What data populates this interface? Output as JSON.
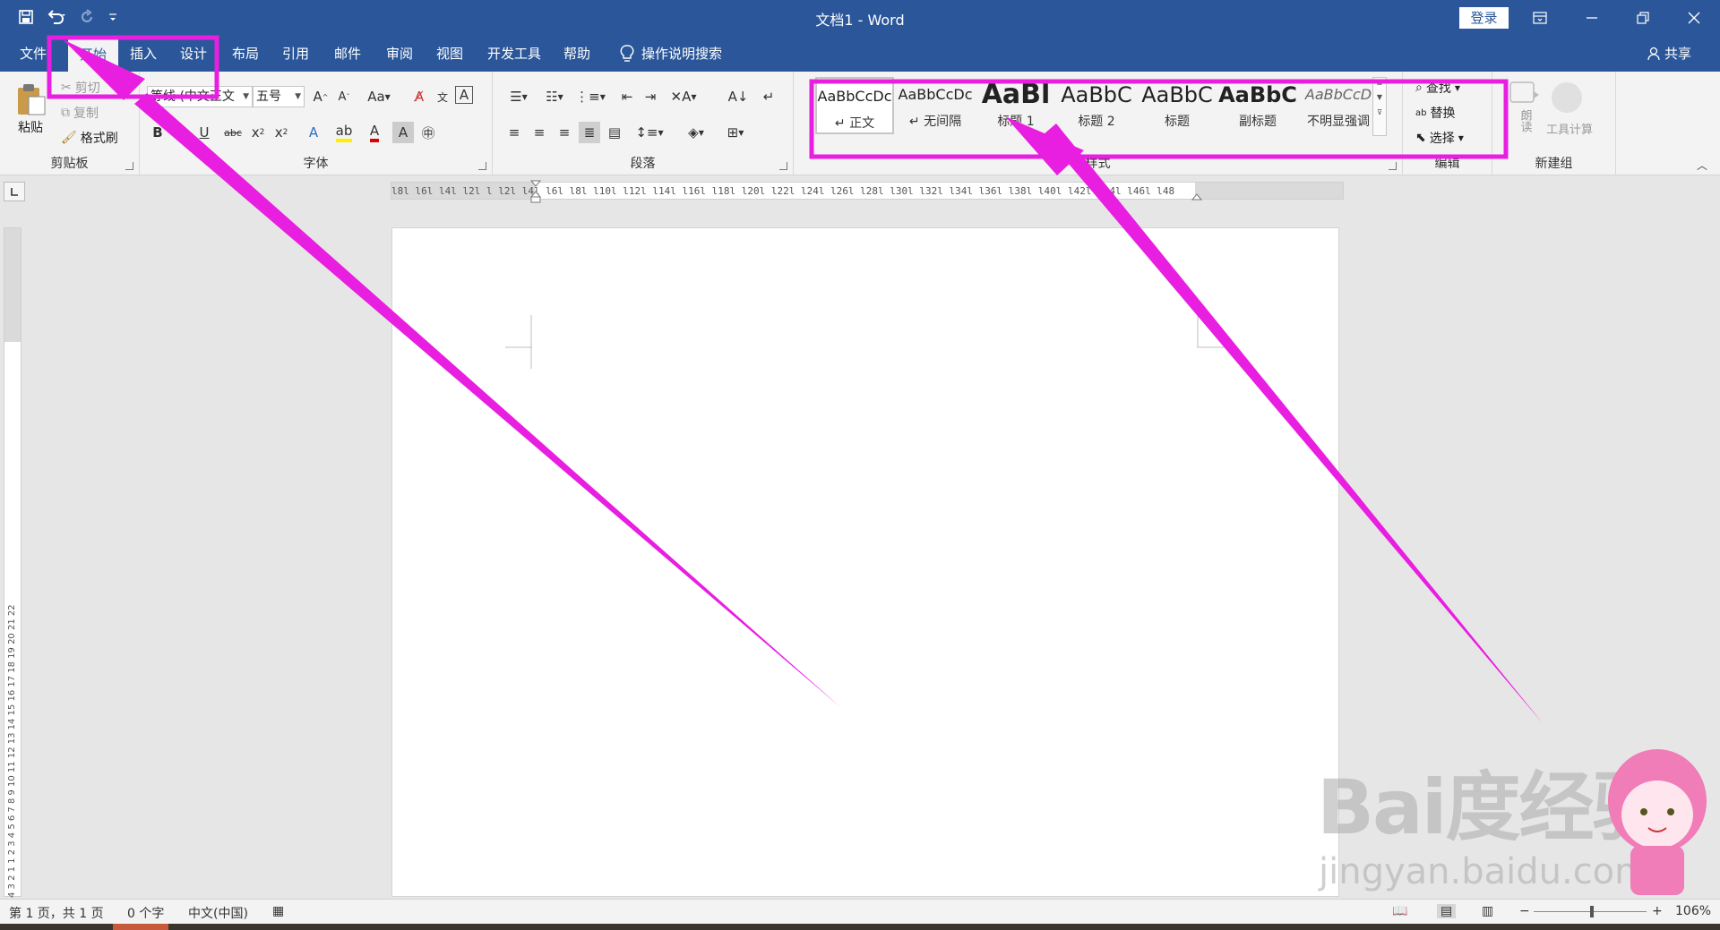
{
  "app": {
    "title": "文档1 - Word",
    "login_label": "登录"
  },
  "tabs": [
    {
      "label": "文件"
    },
    {
      "label": "开始"
    },
    {
      "label": "插入"
    },
    {
      "label": "设计"
    },
    {
      "label": "布局"
    },
    {
      "label": "引用"
    },
    {
      "label": "邮件"
    },
    {
      "label": "审阅"
    },
    {
      "label": "视图"
    },
    {
      "label": "开发工具"
    },
    {
      "label": "帮助"
    }
  ],
  "tell_me": "操作说明搜索",
  "share_label": "共享",
  "clipboard": {
    "paste": "粘贴",
    "cut": "剪切",
    "copy": "复制",
    "format_painter": "格式刷",
    "group": "剪贴板"
  },
  "font": {
    "name": "等线 (中文正文",
    "size": "五号",
    "change_case": "Aa",
    "group": "字体"
  },
  "paragraph": {
    "group": "段落"
  },
  "styles": {
    "items": [
      {
        "sample": "AaBbCcDc",
        "name": "↵ 正文"
      },
      {
        "sample": "AaBbCcDc",
        "name": "↵ 无间隔"
      },
      {
        "sample": "AaBl",
        "name": "标题 1"
      },
      {
        "sample": "AaBbC",
        "name": "标题 2"
      },
      {
        "sample": "AaBbC",
        "name": "标题"
      },
      {
        "sample": "AaBbC",
        "name": "副标题"
      },
      {
        "sample": "AaBbCcD",
        "name": "不明显强调"
      }
    ],
    "group": "样式"
  },
  "editing": {
    "find": "查找",
    "replace": "替换",
    "select": "选择",
    "group": "编辑"
  },
  "new_group": {
    "read_aloud": "朗读",
    "tool_calc": "工具计算",
    "group": "新建组"
  },
  "ruler": {
    "horizontal": "l8l l6l l4l l2l  l  l2l l4l l6l l8l l10l l12l l14l l16l l18l l20l l22l l24l l26l l28l l30l l32l l34l l36l l38l l40l l42l l44l l46l l48",
    "vertical": "4 3 2 1 1 2 3 4 5 6 7 8 9 10 11 12 13 14 15 16 17 18 19 20 21 22"
  },
  "status": {
    "page": "第 1 页，共 1 页",
    "words": "0 个字",
    "language": "中文(中国)",
    "zoom": "106%"
  },
  "watermark": {
    "logo": "Bai度经验",
    "url": "jingyan.baidu.com"
  },
  "colors": {
    "title_bar": "#2b579a",
    "annotation": "#e81ee0",
    "ribbon": "#f3f3f3"
  }
}
